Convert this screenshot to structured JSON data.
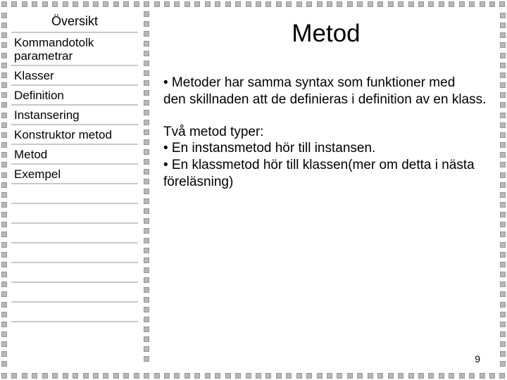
{
  "sidebar": {
    "title": "Översikt",
    "items": [
      "Kommandotolk parametrar",
      "Klasser",
      "Definition",
      "Instansering",
      "Konstruktor metod",
      "Metod",
      "Exempel"
    ]
  },
  "main": {
    "title": "Metod",
    "para1": "• Metoder har samma syntax som funktioner med\n   den skillnaden att de definieras i definition av en klass.",
    "para2": "Två metod typer:\n• En instansmetod hör till instansen.\n• En klassmetod hör till klassen(mer om detta i nästa föreläsning)"
  },
  "page_number": "9"
}
